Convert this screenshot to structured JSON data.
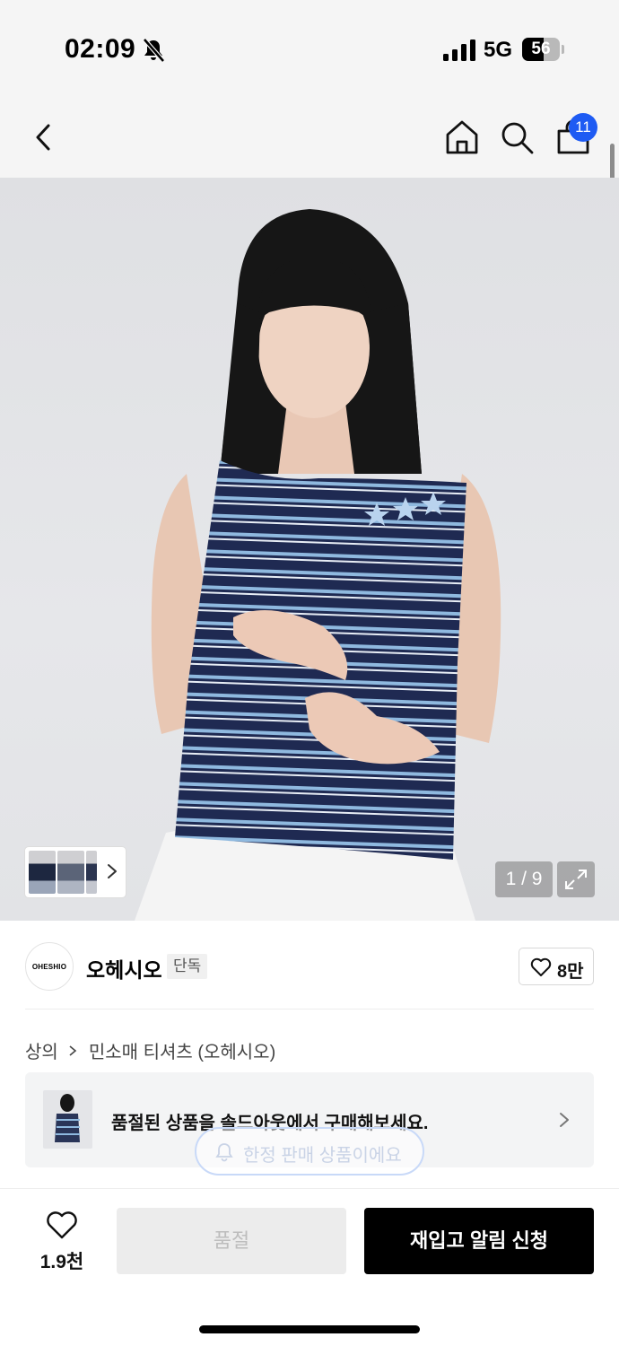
{
  "status_bar": {
    "time": "02:09",
    "network": "5G",
    "battery": "56",
    "battery_level": 0.56,
    "icons": [
      "bell-slash-icon",
      "signal-bars-icon",
      "battery-icon"
    ]
  },
  "nav": {
    "cart_count": "11",
    "icons": [
      "back-chevron-icon",
      "home-icon",
      "search-icon",
      "shopping-bag-icon"
    ]
  },
  "gallery": {
    "page_counter": "1 / 9",
    "icons": [
      "chevron-right-icon",
      "expand-icon"
    ]
  },
  "brand": {
    "logo_text": "OHESHIO",
    "name": "오헤시오",
    "exclusive_badge": "단독",
    "like_count": "8만"
  },
  "breadcrumb": {
    "category": "상의",
    "subcategory": "민소매 티셔츠 (오헤시오)"
  },
  "soldout_banner": {
    "text": "품절된 상품을 솔드아웃에서 구매해보세요."
  },
  "limited_notice": {
    "text": "한정 판매 상품이에요"
  },
  "bottom_bar": {
    "wish_count": "1.9천",
    "soldout_label": "품절",
    "restock_label": "재입고 알림 신청"
  },
  "colors": {
    "accent_blue": "#1e5bf3",
    "primary_black": "#000000",
    "disabled_gray": "#ececec"
  }
}
